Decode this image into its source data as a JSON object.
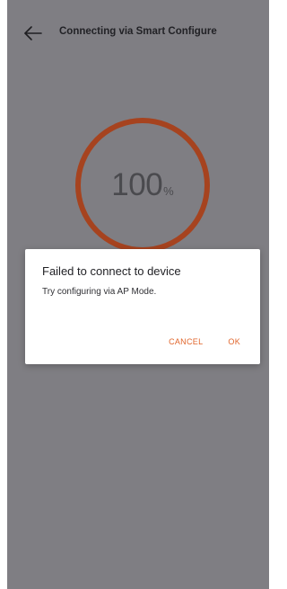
{
  "header": {
    "back_icon": "arrow-left-icon",
    "title": "Connecting via Smart Configure"
  },
  "progress": {
    "value": 100,
    "display_number": "100",
    "unit": "%",
    "ring_color": "#a6431f"
  },
  "dialog": {
    "title": "Failed to connect to device",
    "message": "Try configuring via AP Mode.",
    "cancel_label": "CANCEL",
    "ok_label": "OK",
    "accent_color": "#e1662c"
  },
  "colors": {
    "scrim_background": "#7f7e83"
  }
}
